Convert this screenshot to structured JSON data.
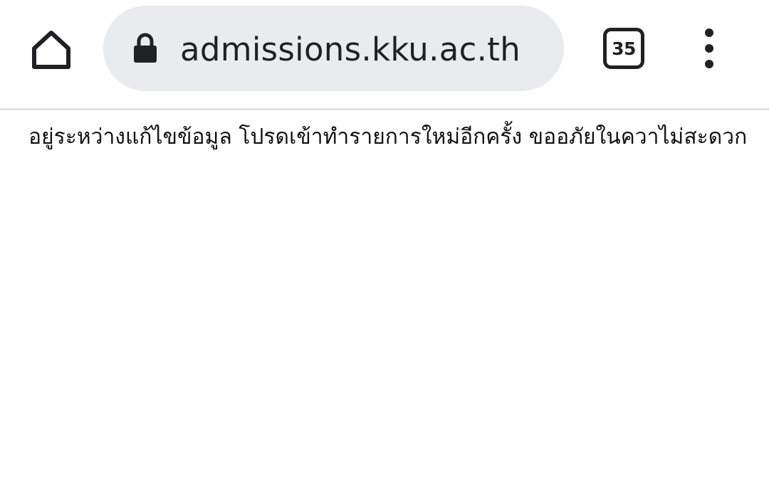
{
  "browser": {
    "url": "admissions.kku.ac.th",
    "tab_count": "35",
    "icons": {
      "home": "home-icon",
      "lock": "lock-icon",
      "tabs": "tab-switcher-icon",
      "menu": "more-vert-icon"
    },
    "colors": {
      "address_bar_bg": "#eaebee",
      "icon_color": "#202124"
    }
  },
  "page": {
    "notice": "อยู่ระหว่างแก้ไขข้อมูล โปรดเข้าทำรายการใหม่อีกครั้ง ขออภัยในควาไม่สะดวก"
  }
}
